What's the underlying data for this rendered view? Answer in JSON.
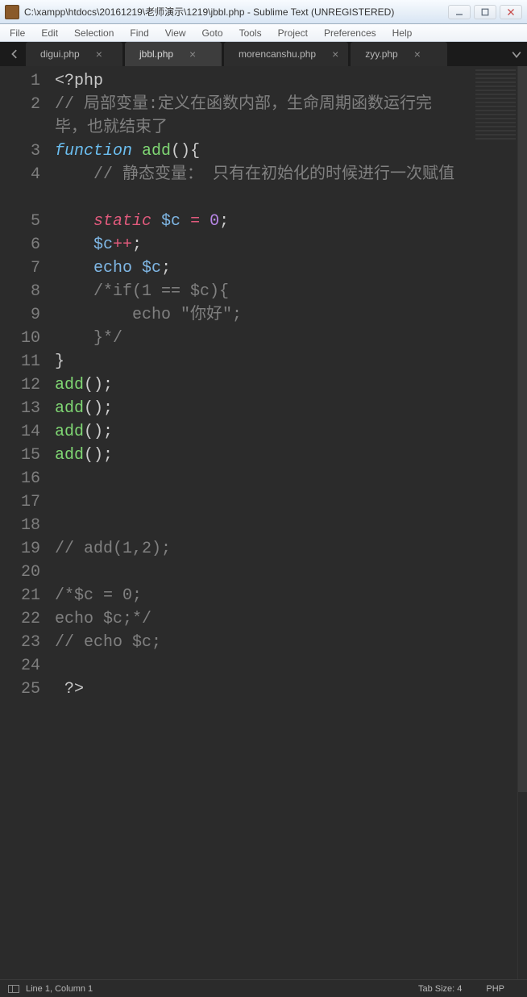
{
  "window": {
    "title": "C:\\xampp\\htdocs\\20161219\\老师演示\\1219\\jbbl.php - Sublime Text (UNREGISTERED)"
  },
  "menu": {
    "items": [
      "File",
      "Edit",
      "Selection",
      "Find",
      "View",
      "Goto",
      "Tools",
      "Project",
      "Preferences",
      "Help"
    ]
  },
  "tabs": {
    "items": [
      {
        "label": "digui.php",
        "active": false
      },
      {
        "label": "jbbl.php",
        "active": true
      },
      {
        "label": "morencanshu.php",
        "active": false
      },
      {
        "label": "zyy.php",
        "active": false
      }
    ]
  },
  "code": {
    "lines": [
      [
        {
          "cls": "tag-open",
          "t": "<?php"
        }
      ],
      [
        {
          "cls": "comment",
          "t": "// 局部变量:定义在函数内部，生命周期函数运行完毕，也就结束了"
        }
      ],
      [
        {
          "cls": "keyword-fn",
          "t": "function"
        },
        {
          "cls": "",
          "t": " "
        },
        {
          "cls": "fn-name",
          "t": "add"
        },
        {
          "cls": "paren",
          "t": "()"
        },
        {
          "cls": "brace",
          "t": "{"
        }
      ],
      [
        {
          "cls": "",
          "t": "    "
        },
        {
          "cls": "comment",
          "t": "// 静态变量： 只有在初始化的时候进行一次赋值"
        }
      ],
      [
        {
          "cls": "",
          "t": "    "
        },
        {
          "cls": "keyword-static",
          "t": "static"
        },
        {
          "cls": "",
          "t": " "
        },
        {
          "cls": "var",
          "t": "$c"
        },
        {
          "cls": "",
          "t": " "
        },
        {
          "cls": "op",
          "t": "="
        },
        {
          "cls": "",
          "t": " "
        },
        {
          "cls": "num",
          "t": "0"
        },
        {
          "cls": "punct",
          "t": ";"
        }
      ],
      [
        {
          "cls": "",
          "t": "    "
        },
        {
          "cls": "var",
          "t": "$c"
        },
        {
          "cls": "op",
          "t": "++"
        },
        {
          "cls": "punct",
          "t": ";"
        }
      ],
      [
        {
          "cls": "",
          "t": "    "
        },
        {
          "cls": "echo",
          "t": "echo"
        },
        {
          "cls": "",
          "t": " "
        },
        {
          "cls": "var",
          "t": "$c"
        },
        {
          "cls": "punct",
          "t": ";"
        }
      ],
      [
        {
          "cls": "",
          "t": "    "
        },
        {
          "cls": "comment",
          "t": "/*if(1 == $c){"
        }
      ],
      [
        {
          "cls": "",
          "t": "        "
        },
        {
          "cls": "comment",
          "t": "echo \"你好\";"
        }
      ],
      [
        {
          "cls": "",
          "t": "    "
        },
        {
          "cls": "comment",
          "t": "}*/"
        }
      ],
      [
        {
          "cls": "brace",
          "t": "}"
        }
      ],
      [
        {
          "cls": "fn-name",
          "t": "add"
        },
        {
          "cls": "paren",
          "t": "()"
        },
        {
          "cls": "punct",
          "t": ";"
        }
      ],
      [
        {
          "cls": "fn-name",
          "t": "add"
        },
        {
          "cls": "paren",
          "t": "()"
        },
        {
          "cls": "punct",
          "t": ";"
        }
      ],
      [
        {
          "cls": "fn-name",
          "t": "add"
        },
        {
          "cls": "paren",
          "t": "()"
        },
        {
          "cls": "punct",
          "t": ";"
        }
      ],
      [
        {
          "cls": "fn-name",
          "t": "add"
        },
        {
          "cls": "paren",
          "t": "()"
        },
        {
          "cls": "punct",
          "t": ";"
        }
      ],
      [],
      [],
      [],
      [
        {
          "cls": "comment",
          "t": "// add(1,2);"
        }
      ],
      [],
      [
        {
          "cls": "comment",
          "t": "/*$c = 0;"
        }
      ],
      [
        {
          "cls": "comment",
          "t": "echo $c;*/"
        }
      ],
      [
        {
          "cls": "comment",
          "t": "// echo $c;"
        }
      ],
      [],
      [
        {
          "cls": "",
          "t": " "
        },
        {
          "cls": "tag-open",
          "t": "?>"
        }
      ]
    ],
    "wrapped_after": {
      "2": 1,
      "4": 1
    }
  },
  "status": {
    "cursor": "Line 1, Column 1",
    "tab_size": "Tab Size: 4",
    "syntax": "PHP"
  }
}
